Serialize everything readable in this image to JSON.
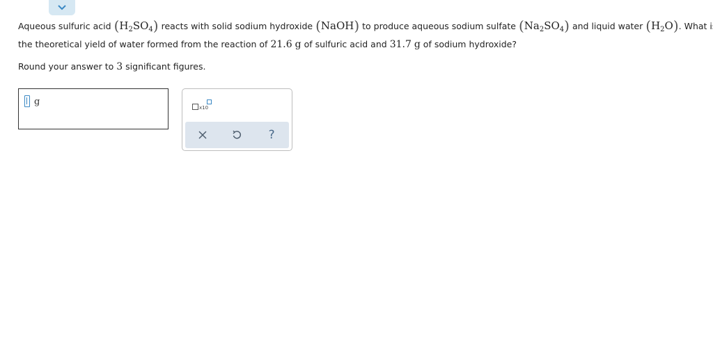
{
  "question": {
    "line1": {
      "t1": "Aqueous sulfuric acid",
      "acid_a": "H",
      "acid_sub": "2",
      "acid_b": "SO",
      "acid_sub2": "4",
      "t2": "reacts with solid sodium hydroxide",
      "base": "NaOH",
      "t3": "to produce aqueous sodium sulfate",
      "salt_a": "Na",
      "salt_sub": "2",
      "salt_b": "SO",
      "salt_sub2": "4",
      "t4": "and liquid water",
      "water_a": "H",
      "water_sub": "2",
      "water_b": "O",
      "t5": ". What is"
    },
    "line2": {
      "t1": "the theoretical yield of water formed from the reaction of",
      "mass_acid": "21.6",
      "unit_g": "g",
      "t2": "of sulfuric acid and",
      "mass_base": "31.7",
      "unit_g2": "g",
      "t3": "of sodium hydroxide?"
    }
  },
  "instruction": {
    "prefix": "Round your answer to",
    "sig_figs": "3",
    "suffix": "significant figures."
  },
  "answer": {
    "value": "",
    "unit": "g"
  },
  "tools": {
    "sci_notation_label": "x10",
    "clear_icon": "x-icon",
    "undo_icon": "undo-icon",
    "help_label": "?"
  },
  "colors": {
    "accent": "#3a88c4",
    "toolbar_bg": "#dde5ee",
    "tab_bg": "#d6e8f3"
  }
}
